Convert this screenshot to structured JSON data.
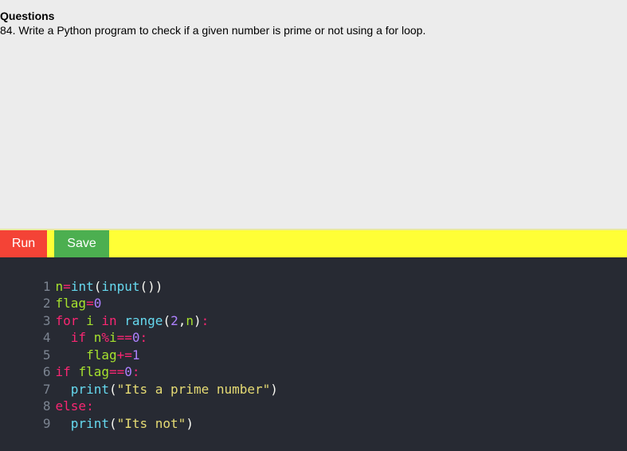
{
  "question": {
    "heading": "Questions",
    "text": "84. Write a Python program to check if a given number is prime or not using a for loop."
  },
  "toolbar": {
    "run_label": "Run",
    "save_label": "Save"
  },
  "editor": {
    "lines": [
      {
        "num": "1",
        "code": "n=int(input())"
      },
      {
        "num": "2",
        "code": "flag=0"
      },
      {
        "num": "3",
        "code": "for i in range(2,n):"
      },
      {
        "num": "4",
        "code": "  if n%i==0:"
      },
      {
        "num": "5",
        "code": "    flag+=1"
      },
      {
        "num": "6",
        "code": "if flag==0:"
      },
      {
        "num": "7",
        "code": "  print(\"Its a prime number\")"
      },
      {
        "num": "8",
        "code": "else:"
      },
      {
        "num": "9",
        "code": "  print(\"Its not\")"
      }
    ]
  },
  "colors": {
    "run": "#f44336",
    "save": "#4caf50",
    "toolbar": "#ffff36",
    "editor_bg": "#272a33"
  }
}
